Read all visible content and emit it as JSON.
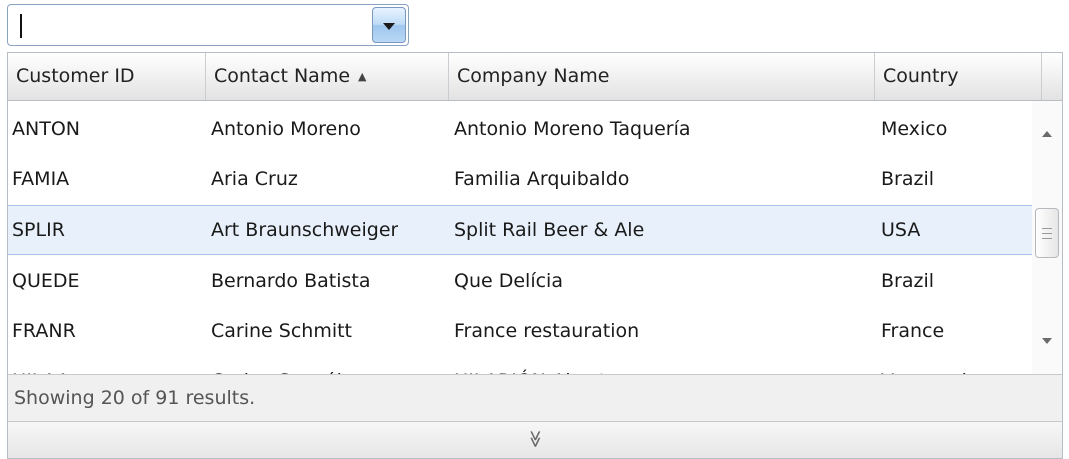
{
  "combo": {
    "value": ""
  },
  "grid": {
    "columns": [
      {
        "label": "Customer ID"
      },
      {
        "label": "Contact Name",
        "sort": "▲"
      },
      {
        "label": "Company Name"
      },
      {
        "label": "Country"
      }
    ],
    "rows": [
      {
        "id": "ANTON",
        "contact": "Antonio Moreno",
        "company": "Antonio Moreno Taquería",
        "country": "Mexico"
      },
      {
        "id": "FAMIA",
        "contact": "Aria Cruz",
        "company": "Familia Arquibaldo",
        "country": "Brazil"
      },
      {
        "id": "SPLIR",
        "contact": "Art Braunschweiger",
        "company": "Split Rail Beer & Ale",
        "country": "USA",
        "selected": true
      },
      {
        "id": "QUEDE",
        "contact": "Bernardo Batista",
        "company": "Que Delícia",
        "country": "Brazil"
      },
      {
        "id": "FRANR",
        "contact": "Carine Schmitt",
        "company": "France restauration",
        "country": "France"
      },
      {
        "id": "HILAA",
        "contact": "Carlos González",
        "company": "HILARIÓN-Abastos",
        "country": "Venezuela"
      }
    ],
    "status": "Showing 20 of 91 results.",
    "expander_glyph": "≫"
  },
  "icons": {
    "combo_dropdown": "chevron-down-icon",
    "sort": "sort-ascending-icon",
    "expand": "expand-down-icon"
  },
  "colors": {
    "selection": "#e8f1fb",
    "accent": "#9fc7ee"
  }
}
